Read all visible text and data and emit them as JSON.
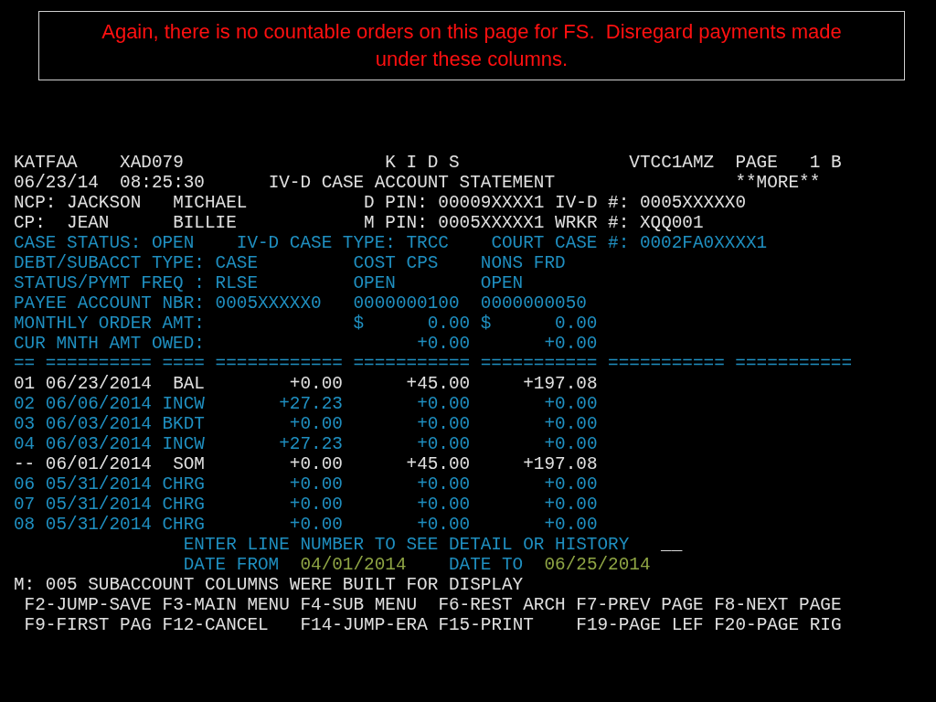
{
  "notice": {
    "text": "Again, there is no countable orders on this page for FS.  Disregard payments made under these columns."
  },
  "terminal": {
    "lines": [
      {
        "segments": [
          {
            "text": "KATFAA    XAD079                   K I D S                VTCC1AMZ  PAGE   1 B",
            "color": "#e0e0e0"
          }
        ]
      },
      {
        "segments": [
          {
            "text": "06/23/14  08:25:30      IV-D CASE ACCOUNT STATEMENT                 **MORE**",
            "color": "#e0e0e0"
          }
        ]
      },
      {
        "segments": [
          {
            "text": "NCP: JACKSON   MICHAEL           D PIN: 00009XXXX1",
            "color": "#e0e0e0"
          },
          {
            "text": " IV-D #: 0005XXXXX0",
            "color": "#e0e0e0"
          }
        ]
      },
      {
        "segments": [
          {
            "text": "CP:  JEAN      BILLIE            M PIN: 0005XXXXX1",
            "color": "#e0e0e0"
          },
          {
            "text": " WRKR #: XQQ001",
            "color": "#e0e0e0"
          }
        ]
      },
      {
        "segments": [
          {
            "text": "CASE STATUS: OPEN    IV-D CASE TYPE: TRCC    COURT CASE #: 0002FA0XXXX1",
            "color": "#1f8fc0"
          }
        ]
      },
      {
        "segments": [
          {
            "text": "DEBT/SUBACCT TYPE: CASE         COST CPS    NONS FRD",
            "color": "#1f8fc0"
          }
        ]
      },
      {
        "segments": [
          {
            "text": "STATUS/PYMT FREQ : RLSE         OPEN        OPEN",
            "color": "#1f8fc0"
          }
        ]
      },
      {
        "segments": [
          {
            "text": "PAYEE ACCOUNT NBR: 0005XXXXX0   0000000100  0000000050",
            "color": "#1f8fc0"
          }
        ]
      },
      {
        "segments": [
          {
            "text": "MONTHLY ORDER AMT:              $      0.00 $      0.00",
            "color": "#1f8fc0"
          }
        ]
      },
      {
        "segments": [
          {
            "text": "CUR MNTH AMT OWED:                    +0.00       +0.00",
            "color": "#1f8fc0"
          }
        ]
      },
      {
        "segments": [
          {
            "text": "== ========== ==== ============ =========== =========== =========== ===========",
            "color": "#1f8fc0"
          }
        ]
      },
      {
        "segments": [
          {
            "text": "01 06/23/2014  BAL        +0.00      +45.00     +197.08",
            "color": "#e0e0e0"
          }
        ]
      },
      {
        "segments": [
          {
            "text": "02 06/06/2014 INCW       +27.23       +0.00       +0.00",
            "color": "#1f8fc0"
          }
        ]
      },
      {
        "segments": [
          {
            "text": "03 06/03/2014 BKDT        +0.00       +0.00       +0.00",
            "color": "#1f8fc0"
          }
        ]
      },
      {
        "segments": [
          {
            "text": "04 06/03/2014 INCW       +27.23       +0.00       +0.00",
            "color": "#1f8fc0"
          }
        ]
      },
      {
        "segments": [
          {
            "text": "-- 06/01/2014  SOM        +0.00      +45.00     +197.08",
            "color": "#e0e0e0"
          }
        ]
      },
      {
        "segments": [
          {
            "text": "06 05/31/2014 CHRG        +0.00       +0.00       +0.00",
            "color": "#1f8fc0"
          }
        ]
      },
      {
        "segments": [
          {
            "text": "07 05/31/2014 CHRG        +0.00       +0.00       +0.00",
            "color": "#1f8fc0"
          }
        ]
      },
      {
        "segments": [
          {
            "text": "08 05/31/2014 CHRG        +0.00       +0.00       +0.00",
            "color": "#1f8fc0"
          }
        ]
      },
      {
        "segments": [
          {
            "text": "                ENTER LINE NUMBER TO SEE DETAIL OR HISTORY   ",
            "color": "#1f8fc0"
          }
        ],
        "field": "__"
      },
      {
        "segments": [
          {
            "text": "                DATE FROM  ",
            "color": "#1f8fc0"
          },
          {
            "text": "04/01/2014",
            "color": "#8fa544"
          },
          {
            "text": "    DATE TO  ",
            "color": "#1f8fc0"
          },
          {
            "text": "06/25/2014",
            "color": "#8fa544"
          }
        ]
      },
      {
        "segments": [
          {
            "text": "M: 005 SUBACCOUNT COLUMNS WERE BUILT FOR DISPLAY",
            "color": "#e0e0e0"
          }
        ]
      },
      {
        "segments": [
          {
            "text": " F2-JUMP-SAVE",
            "color": "#e0e0e0"
          },
          {
            "text": " F3-MAIN MENU",
            "color": "#e0e0e0"
          },
          {
            "text": " F4-SUB MENU",
            "color": "#e0e0e0"
          },
          {
            "text": "  F6-REST ARCH",
            "color": "#e0e0e0"
          },
          {
            "text": " F7-PREV PAGE",
            "color": "#e0e0e0"
          },
          {
            "text": " F8-NEXT PAGE",
            "color": "#e0e0e0"
          }
        ]
      },
      {
        "segments": [
          {
            "text": " F9-FIRST PAG",
            "color": "#e0e0e0"
          },
          {
            "text": " F12-CANCEL",
            "color": "#e0e0e0"
          },
          {
            "text": "   F14-JUMP-ERA",
            "color": "#e0e0e0"
          },
          {
            "text": " F15-PRINT",
            "color": "#e0e0e0"
          },
          {
            "text": "    F19-PAGE LEF",
            "color": "#e0e0e0"
          },
          {
            "text": " F20-PAGE RIG",
            "color": "#e0e0e0"
          }
        ]
      }
    ]
  }
}
